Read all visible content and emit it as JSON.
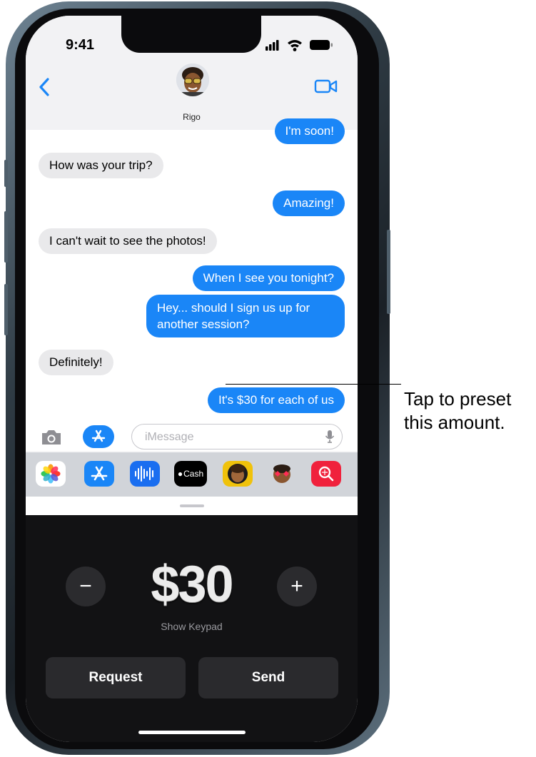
{
  "status": {
    "time": "9:41"
  },
  "contact": {
    "name": "Rigo"
  },
  "messages": [
    {
      "side": "out",
      "text": "I'm soon!"
    },
    {
      "side": "in",
      "text": "How was your trip?"
    },
    {
      "side": "out",
      "text": "Amazing!"
    },
    {
      "side": "in",
      "text": "I can't wait to see the photos!"
    },
    {
      "side": "out",
      "text": "When I see you tonight?"
    },
    {
      "side": "out",
      "text": "Hey... should I sign us up for another session?"
    },
    {
      "side": "in",
      "text": "Definitely!"
    },
    {
      "side": "out",
      "text": "It's $30 for each of us"
    }
  ],
  "compose": {
    "placeholder": "iMessage"
  },
  "apps": [
    "photos-icon",
    "app-store-icon",
    "audio-waveform-icon",
    "apple-cash-icon",
    "memoji-icon",
    "memoji-stickers-icon",
    "search-images-icon"
  ],
  "apps_labels": {
    "cash": "Cash"
  },
  "pay": {
    "amount": "$30",
    "minus": "−",
    "plus": "+",
    "keypad_label": "Show Keypad",
    "request_label": "Request",
    "send_label": "Send"
  },
  "callout": {
    "line1": "Tap to preset",
    "line2": "this amount."
  },
  "colors": {
    "bubble_out": "#1a86f7",
    "bubble_in": "#e9e9eb",
    "accent": "#1a86f7",
    "pay_panel": "#121214"
  }
}
